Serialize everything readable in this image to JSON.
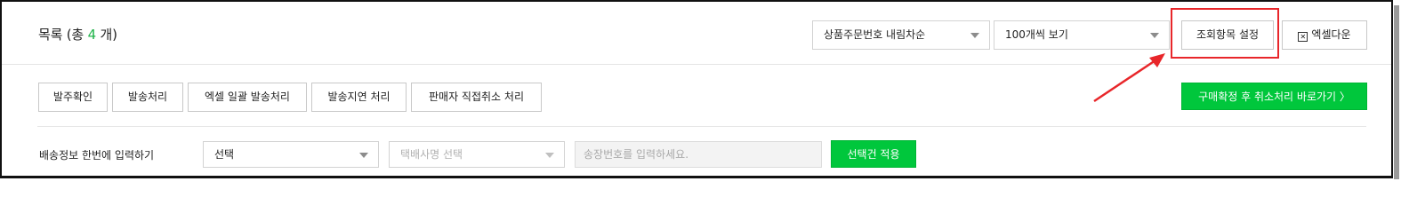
{
  "header": {
    "title_prefix": "목록 (총 ",
    "title_count": "4",
    "title_suffix": " 개)",
    "sort_select": "상품주문번호 내림차순",
    "page_size_select": "100개씩 보기",
    "query_settings_button": "조회항목 설정",
    "excel_download_button": "엑셀다운",
    "excel_icon": "excel-icon"
  },
  "actions": {
    "buttons": [
      "발주확인",
      "발송처리",
      "엑셀 일괄 발송처리",
      "발송지연 처리",
      "판매자 직접취소 처리"
    ],
    "green_button": "구매확정 후 취소처리 바로가기 〉"
  },
  "shipping": {
    "label": "배송정보 한번에 입력하기",
    "method_select": "선택",
    "courier_select": "택배사명 선택",
    "tracking_placeholder": "송장번호를 입력하세요.",
    "apply_button": "선택건 적용"
  },
  "colors": {
    "accent_green": "#00c73c",
    "count_green": "#1fb349",
    "annotation_red": "#e8262a"
  }
}
